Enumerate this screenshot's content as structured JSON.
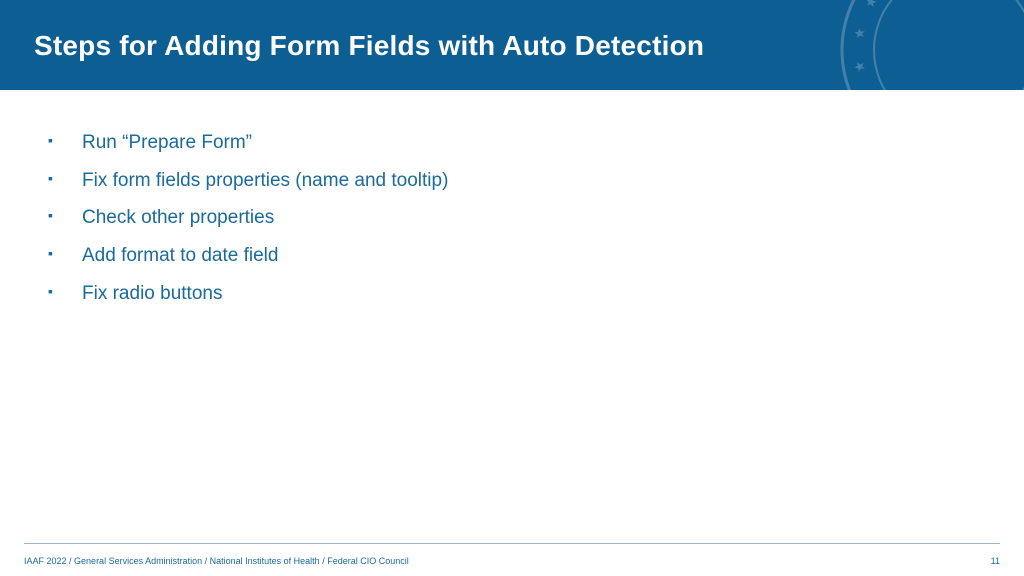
{
  "header": {
    "title": "Steps for Adding Form Fields with Auto Detection"
  },
  "bullets": [
    "Run “Prepare Form”",
    "Fix form fields properties (name and tooltip)",
    "Check other properties",
    "Add format to date field",
    "Fix radio buttons"
  ],
  "footer": {
    "segments": [
      "IAAF 2022",
      "General Services Administration",
      "National Institutes of Health",
      "Federal CIO Council"
    ],
    "page": "11"
  }
}
